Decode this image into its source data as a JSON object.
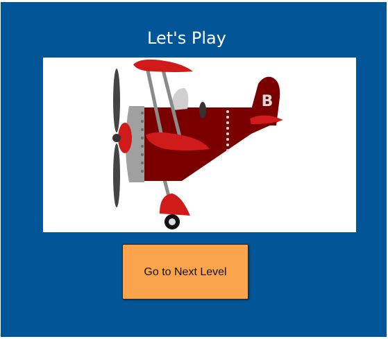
{
  "page": {
    "title": "Let's Play"
  },
  "illustration": {
    "subject": "red-biplane",
    "tail_letter": "B"
  },
  "actions": {
    "next_level_label": "Go to Next Level"
  },
  "colors": {
    "panel_background": "#025596",
    "button_background": "#fca44c",
    "plane_red": "#c8101b",
    "plane_dark_red": "#7a0000"
  }
}
